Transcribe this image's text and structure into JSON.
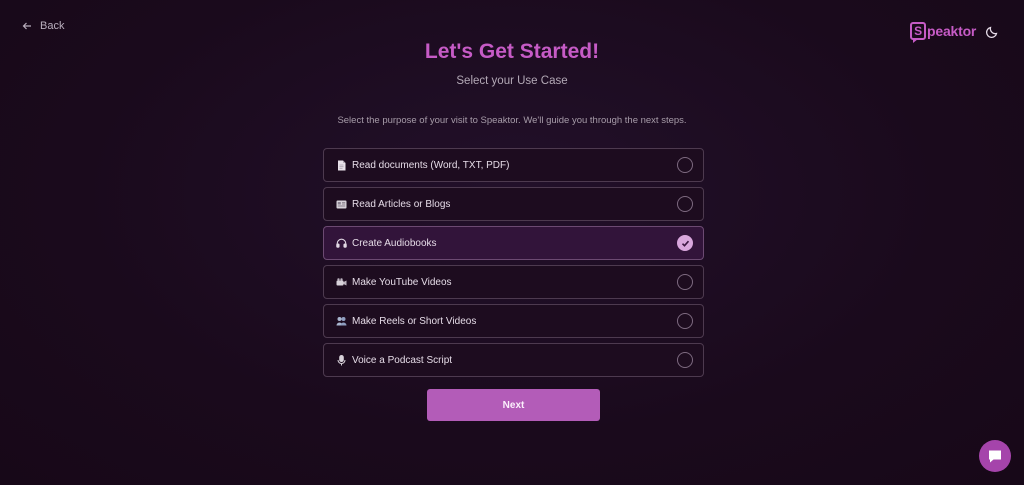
{
  "nav": {
    "back_label": "Back"
  },
  "brand": {
    "logo_letter": "S",
    "logo_rest": "peaktor"
  },
  "header": {
    "title": "Let's Get Started!",
    "subtitle": "Select your Use Case",
    "description": "Select the purpose of your visit to Speaktor. We'll guide you through the next steps."
  },
  "options": [
    {
      "label": "Read documents (Word, TXT, PDF)",
      "icon": "document-icon",
      "selected": false
    },
    {
      "label": "Read Articles or Blogs",
      "icon": "newspaper-icon",
      "selected": false
    },
    {
      "label": "Create Audiobooks",
      "icon": "headphones-icon",
      "selected": true
    },
    {
      "label": "Make YouTube Videos",
      "icon": "video-camera-icon",
      "selected": false
    },
    {
      "label": "Make Reels or Short Videos",
      "icon": "people-icon",
      "selected": false
    },
    {
      "label": "Voice a Podcast Script",
      "icon": "microphone-icon",
      "selected": false
    }
  ],
  "actions": {
    "next_label": "Next"
  },
  "colors": {
    "accent": "#c65bc6",
    "button": "#b35cb8",
    "background": "#1b0a1c"
  }
}
